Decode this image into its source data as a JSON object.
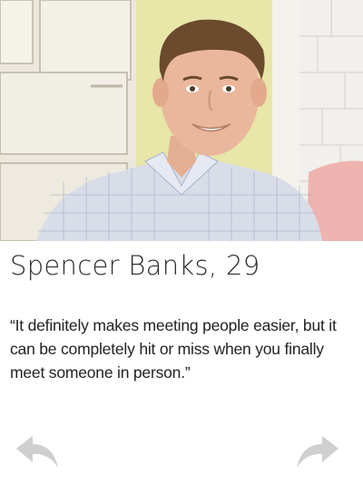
{
  "profile": {
    "name": "Spencer Banks",
    "separator": ", ",
    "age": "29",
    "quote": "“It definitely makes meeting people easier, but it can be completely hit or miss when you finally meet someone in person.”",
    "photo": "profile-photo"
  },
  "navigation": {
    "prev_icon": "back-arrow-icon",
    "next_icon": "forward-arrow-icon"
  },
  "colors": {
    "arrow": "#cfcfcf",
    "text": "#222222"
  }
}
